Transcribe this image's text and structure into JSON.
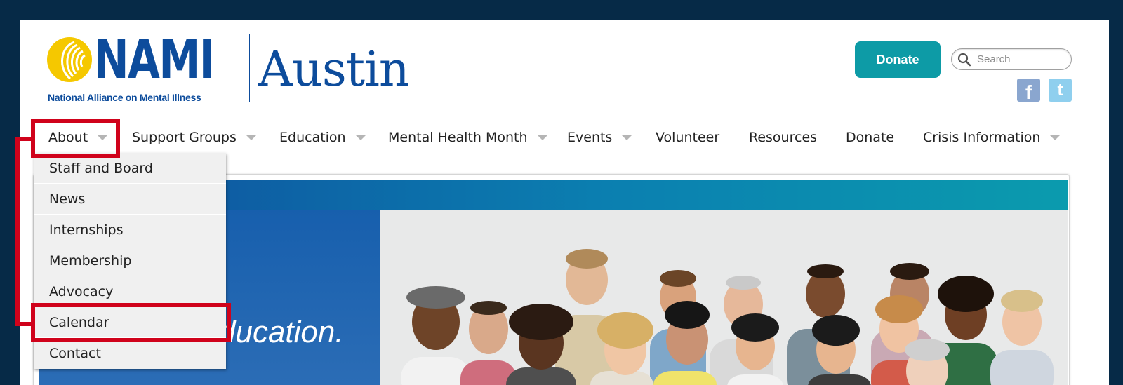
{
  "logo": {
    "brand": "NAMI",
    "city": "Austin",
    "tagline": "National Alliance on Mental Illness"
  },
  "header": {
    "donate_label": "Donate",
    "search_placeholder": "Search",
    "social": [
      {
        "name": "facebook",
        "glyph": "f"
      },
      {
        "name": "twitter",
        "glyph": "t"
      }
    ]
  },
  "nav": {
    "items": [
      {
        "label": "About",
        "has_dropdown": true
      },
      {
        "label": "Support Groups",
        "has_dropdown": true
      },
      {
        "label": "Education",
        "has_dropdown": true
      },
      {
        "label": "Mental Health Month",
        "has_dropdown": true
      },
      {
        "label": "Events",
        "has_dropdown": true
      },
      {
        "label": "Volunteer",
        "has_dropdown": false
      },
      {
        "label": "Resources",
        "has_dropdown": false
      },
      {
        "label": "Donate",
        "has_dropdown": false
      },
      {
        "label": "Crisis Information",
        "has_dropdown": true
      }
    ]
  },
  "about_menu": {
    "items": [
      "Staff and Board",
      "News",
      "Internships",
      "Membership",
      "Advocacy",
      "Calendar",
      "Contact"
    ]
  },
  "hero": {
    "text": "ducation."
  },
  "colors": {
    "background": "#062a47",
    "brand_blue": "#0d4c9c",
    "brand_yellow": "#f5c800",
    "donate_teal": "#0d9ba6",
    "annotation_red": "#d0021b"
  }
}
